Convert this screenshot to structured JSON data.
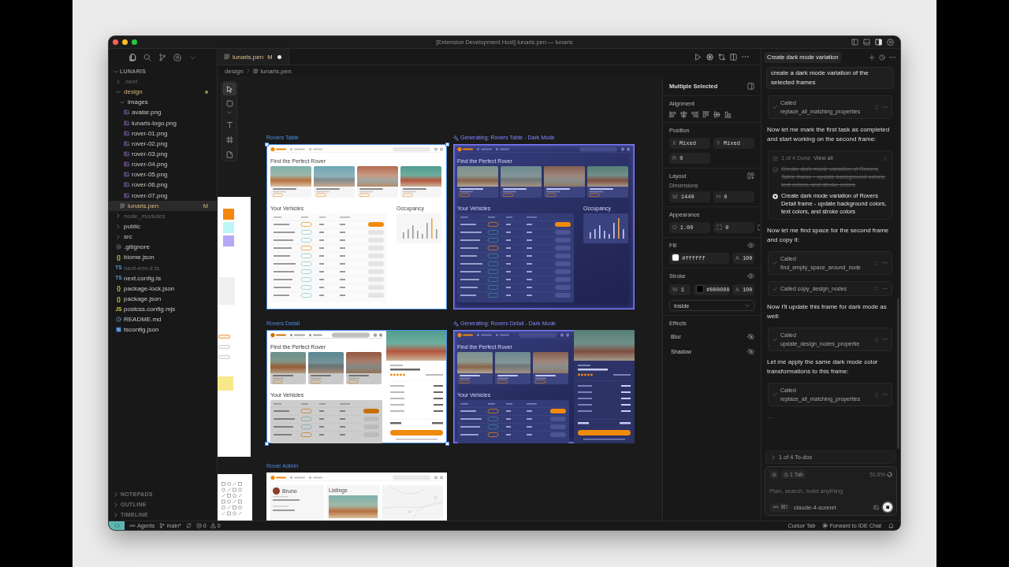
{
  "window": {
    "title": "[Extension Development Host] lunaris.pen — lunaris",
    "actions": [
      {
        "kind": "left-sidebar",
        "on": false
      },
      {
        "kind": "bottom-panel",
        "on": false
      },
      {
        "kind": "right-sidebar",
        "on": true
      },
      {
        "kind": "settings",
        "on": false
      }
    ]
  },
  "sidebar": {
    "views": [
      {
        "kind": "files",
        "selected": true
      },
      {
        "kind": "search",
        "selected": false
      },
      {
        "kind": "source-control",
        "selected": false
      },
      {
        "kind": "extensions",
        "selected": false
      },
      {
        "kind": "menu",
        "selected": false
      }
    ],
    "explorer": {
      "title": "LUNARIS",
      "expanded": true,
      "items": [
        {
          "label": ".next",
          "kind": "folder",
          "expanded": false,
          "selected": false,
          "ignored": true,
          "modified": false
        },
        {
          "label": "design",
          "kind": "folder",
          "expanded": true,
          "selected": false,
          "ignored": false,
          "modified": true,
          "children": [
            {
              "label": "images",
              "kind": "folder",
              "expanded": true,
              "selected": false,
              "ignored": false,
              "modified": false,
              "children": [
                {
                  "label": "avatar.png",
                  "kind": "image",
                  "selected": false,
                  "ignored": false,
                  "modified": false
                },
                {
                  "label": "lunaris-logo.png",
                  "kind": "image",
                  "selected": false,
                  "ignored": false,
                  "modified": false
                },
                {
                  "label": "rover-01.png",
                  "kind": "image",
                  "selected": false,
                  "ignored": false,
                  "modified": false
                },
                {
                  "label": "rover-02.png",
                  "kind": "image",
                  "selected": false,
                  "ignored": false,
                  "modified": false
                },
                {
                  "label": "rover-03.png",
                  "kind": "image",
                  "selected": false,
                  "ignored": false,
                  "modified": false
                },
                {
                  "label": "rover-04.png",
                  "kind": "image",
                  "selected": false,
                  "ignored": false,
                  "modified": false
                },
                {
                  "label": "rover-05.png",
                  "kind": "image",
                  "selected": false,
                  "ignored": false,
                  "modified": false
                },
                {
                  "label": "rover-06.png",
                  "kind": "image",
                  "selected": false,
                  "ignored": false,
                  "modified": false
                },
                {
                  "label": "rover-07.png",
                  "kind": "image",
                  "selected": false,
                  "ignored": false,
                  "modified": false
                }
              ]
            },
            {
              "label": "lunaris.pen",
              "kind": "pen",
              "badge": "M",
              "selected": true,
              "ignored": false,
              "modified": true
            }
          ]
        },
        {
          "label": "node_modules",
          "kind": "folder",
          "expanded": false,
          "selected": false,
          "ignored": true,
          "modified": false
        },
        {
          "label": "public",
          "kind": "folder",
          "expanded": false,
          "selected": false,
          "ignored": false,
          "modified": false
        },
        {
          "label": "src",
          "kind": "folder",
          "expanded": false,
          "selected": false,
          "ignored": false,
          "modified": false
        },
        {
          "label": ".gitignore",
          "kind": "ignore",
          "selected": false,
          "ignored": false,
          "modified": false
        },
        {
          "label": "biome.json",
          "kind": "json",
          "glyph": "{}",
          "selected": false,
          "ignored": false,
          "modified": false
        },
        {
          "label": "next-env.d.ts",
          "kind": "ts",
          "glyph": "TS",
          "selected": false,
          "ignored": true,
          "modified": false
        },
        {
          "label": "next.config.ts",
          "kind": "ts",
          "glyph": "TS",
          "selected": false,
          "ignored": false,
          "modified": false
        },
        {
          "label": "package-lock.json",
          "kind": "json",
          "glyph": "{}",
          "selected": false,
          "ignored": false,
          "modified": false
        },
        {
          "label": "package.json",
          "kind": "json",
          "glyph": "{}",
          "selected": false,
          "ignored": false,
          "modified": false
        },
        {
          "label": "postcss.config.mjs",
          "kind": "js",
          "glyph": "JS",
          "selected": false,
          "ignored": false,
          "modified": false
        },
        {
          "label": "README.md",
          "kind": "info",
          "selected": false,
          "ignored": false,
          "modified": false
        },
        {
          "label": "tsconfig.json",
          "kind": "config",
          "selected": false,
          "ignored": false,
          "modified": false
        }
      ]
    },
    "sections": [
      {
        "label": "NOTEPADS",
        "expanded": false
      },
      {
        "label": "OUTLINE",
        "expanded": false
      },
      {
        "label": "TIMELINE",
        "expanded": false
      }
    ]
  },
  "editor": {
    "tab": {
      "label": "lunaris.pen",
      "badge": "M",
      "modified": true,
      "dirty": true
    },
    "breadcrumb": [
      {
        "label": "design",
        "kind": "folder"
      },
      {
        "label": "lunaris.pen",
        "kind": "pen"
      }
    ],
    "tools": [
      {
        "kind": "pointer",
        "selected": true
      },
      {
        "kind": "rectangle",
        "selected": false
      },
      {
        "kind": "shape-menu",
        "selected": false
      },
      {
        "kind": "text",
        "selected": false
      },
      {
        "kind": "frame",
        "selected": false
      },
      {
        "kind": "note",
        "selected": false
      }
    ]
  },
  "canvas": {
    "frames": [
      {
        "label": "Rovers Table",
        "kind": "table",
        "dark": false,
        "selected": true,
        "generating": false,
        "heading": "Find the Perfect Rover",
        "section": "Your Vehicles",
        "aside": "Occupancy"
      },
      {
        "label": "Generating: Rovers Table - Dark Mode",
        "kind": "table",
        "dark": true,
        "selected": false,
        "generating": true,
        "heading": "Find the Perfect Rover",
        "section": "Your Vehicles",
        "aside": "Occupancy"
      },
      {
        "label": "Rovers Detail",
        "kind": "detail",
        "dark": false,
        "selected": true,
        "generating": false,
        "heading": "Find the Perfect Rover",
        "section": "Your Vehicles"
      },
      {
        "label": "Generating: Rovers Detail - Dark Mode",
        "kind": "detail",
        "dark": true,
        "selected": false,
        "generating": true,
        "heading": "Find the Perfect Rover",
        "section": "Your Vehicles"
      },
      {
        "label": "Rover Admin",
        "kind": "admin",
        "dark": false,
        "selected": false,
        "generating": false,
        "profile": "Bruno",
        "section": "Listings"
      }
    ],
    "swatches": [
      {
        "color": "#f5870c"
      },
      {
        "color": "#bbf6f6"
      },
      {
        "color": "#b6a8f5"
      }
    ]
  },
  "properties": {
    "title": "Multiple Selected",
    "alignment": {
      "label": "Alignment"
    },
    "position": {
      "label": "Position",
      "fields": [
        {
          "prefix": "X",
          "value": "Mixed"
        },
        {
          "prefix": "Y",
          "value": "Mixed"
        },
        {
          "prefix": "R",
          "value": "0"
        }
      ]
    },
    "layout": {
      "label": "Layout",
      "sublabel": "Dimensions",
      "fields": [
        {
          "prefix": "W",
          "value": "1440"
        },
        {
          "prefix": "H",
          "value": "0"
        }
      ]
    },
    "appearance": {
      "label": "Appearance",
      "opacity": {
        "prefix": "O",
        "value": "1.00"
      },
      "radius": {
        "value": "0"
      }
    },
    "fill": {
      "label": "Fill",
      "visible": true,
      "color": "#ffffff",
      "value": "#ffffff",
      "alpha": {
        "prefix": "A",
        "value": "100"
      }
    },
    "stroke": {
      "label": "Stroke",
      "visible": true,
      "width": {
        "prefix": "W",
        "value": "1"
      },
      "color": "#000000",
      "value": "#000000",
      "alpha": {
        "prefix": "A",
        "value": "100"
      },
      "position": "Inside"
    },
    "effects": {
      "label": "Effects",
      "items": [
        {
          "label": "Blur",
          "enabled": false
        },
        {
          "label": "Shadow",
          "enabled": false
        }
      ]
    }
  },
  "chat": {
    "tab": {
      "label": "Create dark mode variation",
      "selected": true
    },
    "messages": [
      {
        "kind": "user",
        "text": "create a dark mode variation of the selected frames"
      },
      {
        "kind": "tool",
        "title": "Called",
        "tool": "replace_all_matching_properties",
        "done": true
      },
      {
        "kind": "text",
        "text": "Now let me mark the first task as completed and start working on the second frame:"
      },
      {
        "kind": "todos",
        "summary": "1 of 4 Done",
        "link": "View all",
        "items": [
          {
            "text": "Create dark mode variation of Rovers Table frame - update background colors, text colors, and stroke colors",
            "done": true
          },
          {
            "text": "Create dark mode variation of Rovers Detail frame - update background colors, text colors, and stroke colors",
            "done": false
          }
        ]
      },
      {
        "kind": "text",
        "text": "Now let me find space for the second frame and copy it:"
      },
      {
        "kind": "tool",
        "title": "Called",
        "tool": "find_empty_space_around_node",
        "done": true
      },
      {
        "kind": "tool-line",
        "text": "Called copy_design_nodes",
        "done": true
      },
      {
        "kind": "text",
        "text": "Now I'll update this frame for dark mode as well:"
      },
      {
        "kind": "tool",
        "title": "Called",
        "tool": "update_design_nodes_propertie",
        "done": true
      },
      {
        "kind": "text",
        "text": "Let me apply the same dark mode color transformations to this frame:"
      },
      {
        "kind": "tool",
        "title": "Called",
        "tool": "replace_all_matching_properties",
        "done": true
      },
      {
        "kind": "pending",
        "text": "..."
      }
    ],
    "todo_bar": {
      "label": "1 of 4 To-dos",
      "expanded": false
    },
    "composer": {
      "context": "1 Tab",
      "usage": "51.6%",
      "placeholder": "Plan, search, build anything",
      "mode": "⌘I",
      "model": "claude-4-sonnet",
      "running": true
    }
  },
  "status_bar": {
    "agents": "Agents",
    "branch": "main*",
    "errors": "0",
    "warnings": "0",
    "cursor_tab": "Cursor Tab",
    "forward": "Forward to IDE Chat"
  }
}
